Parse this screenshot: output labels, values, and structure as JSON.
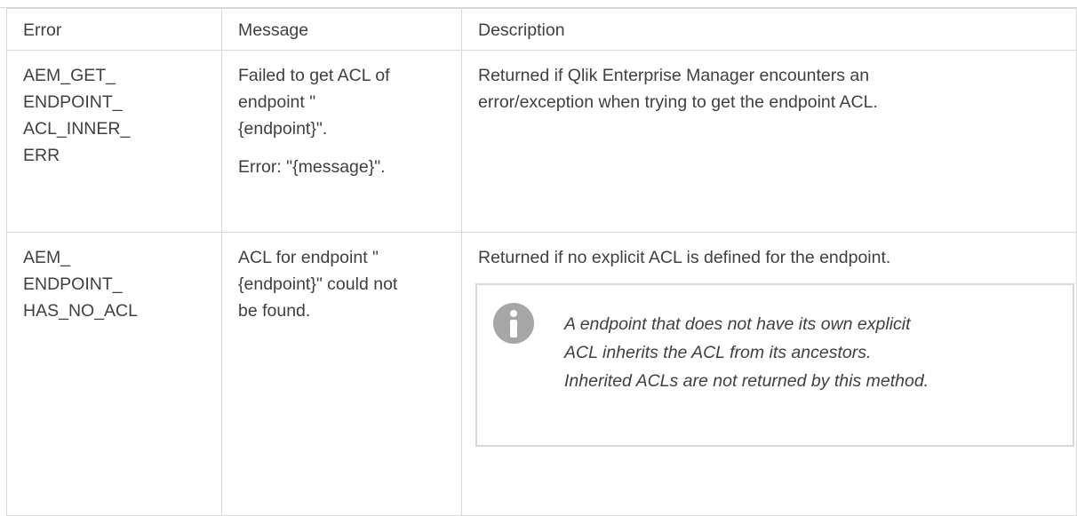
{
  "table": {
    "headers": {
      "error": "Error",
      "message": "Message",
      "description": "Description"
    },
    "rows": [
      {
        "error_lines": [
          "AEM_GET_",
          "ENDPOINT_",
          "ACL_INNER_",
          "ERR"
        ],
        "message_lines": [
          "Failed to get ACL of",
          "endpoint \"",
          "{endpoint}\"."
        ],
        "message_error_line": "Error: \"{message}\".",
        "description_lines": [
          "Returned if Qlik Enterprise Manager encounters an",
          "error/exception when trying to get the endpoint ACL."
        ]
      },
      {
        "error_lines": [
          "AEM_",
          "ENDPOINT_",
          "HAS_NO_ACL"
        ],
        "message_lines": [
          "ACL for endpoint \"",
          "{endpoint}\" could not",
          "be found."
        ],
        "description": "Returned if no explicit ACL is defined for the endpoint.",
        "note": {
          "icon": "info-icon",
          "lines": [
            "A endpoint that does not have its own explicit",
            "ACL inherits the ACL from its ancestors.",
            "Inherited ACLs are not returned by this method."
          ]
        }
      }
    ]
  }
}
